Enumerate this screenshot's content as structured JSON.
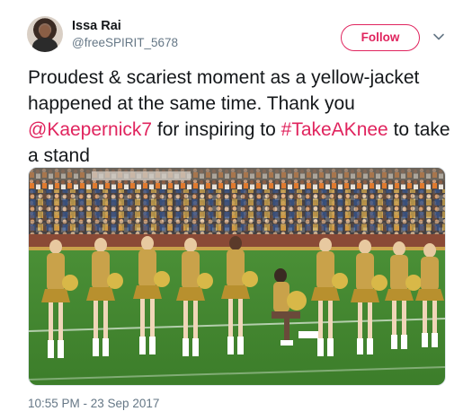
{
  "user": {
    "display_name": "Issa Rai",
    "handle": "@freeSPIRIT_5678"
  },
  "actions": {
    "follow_label": "Follow"
  },
  "tweet": {
    "text_part1": "Proudest & scariest moment as a yellow-jacket happened at the same time. Thank you ",
    "mention": "@Kaepernick7",
    "text_part2": " for inspiring to ",
    "hashtag": "#TakeAKnee",
    "text_part3": " to take a stand",
    "timestamp": "10:55 PM - 23 Sep 2017"
  },
  "colors": {
    "accent": "#e0245e",
    "text": "#14171a",
    "secondary_text": "#657786"
  },
  "icons": {
    "more": "chevron-down-icon"
  }
}
